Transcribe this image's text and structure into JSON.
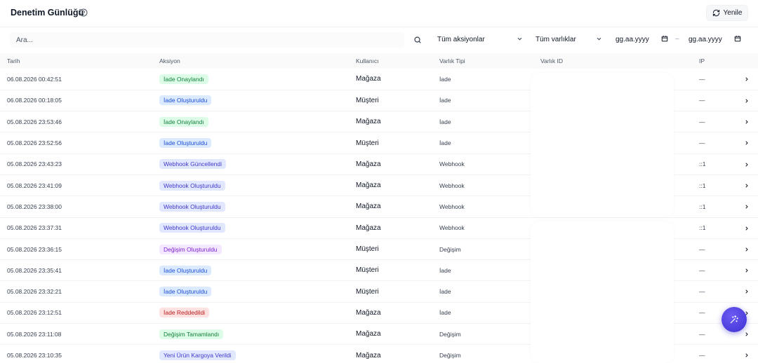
{
  "header": {
    "title": "Denetim Günlüğü",
    "refresh_label": "Yenile"
  },
  "filters": {
    "search_placeholder": "Ara...",
    "action_select": "Tüm aksiyonlar",
    "entity_select": "Tüm varlıklar",
    "date_from_placeholder": "gg.aa.yyyy",
    "date_to_placeholder": "gg.aa.yyyy",
    "date_separator": "–"
  },
  "table": {
    "columns": [
      "Tarih",
      "Aksiyon",
      "Kullanıcı",
      "Varlık Tipi",
      "Varlık ID",
      "IP"
    ],
    "rows": [
      {
        "date": "06.08.2026 00:42:51",
        "action": "İade Onaylandı",
        "color": "green",
        "user": "Mağaza",
        "entity_type": "İade",
        "ip": "—"
      },
      {
        "date": "06.08.2026 00:18:05",
        "action": "İade Oluşturuldu",
        "color": "blue",
        "user": "Müşteri",
        "entity_type": "İade",
        "ip": "—"
      },
      {
        "date": "05.08.2026 23:53:46",
        "action": "İade Onaylandı",
        "color": "green",
        "user": "Mağaza",
        "entity_type": "İade",
        "ip": "—"
      },
      {
        "date": "05.08.2026 23:52:56",
        "action": "İade Oluşturuldu",
        "color": "blue",
        "user": "Müşteri",
        "entity_type": "İade",
        "ip": "—"
      },
      {
        "date": "05.08.2026 23:43:23",
        "action": "Webhook Güncellendi",
        "color": "indigo",
        "user": "Mağaza",
        "entity_type": "Webhook",
        "ip": "::1"
      },
      {
        "date": "05.08.2026 23:41:09",
        "action": "Webhook Oluşturuldu",
        "color": "indigo",
        "user": "Mağaza",
        "entity_type": "Webhook",
        "ip": "::1"
      },
      {
        "date": "05.08.2026 23:38:00",
        "action": "Webhook Oluşturuldu",
        "color": "indigo",
        "user": "Mağaza",
        "entity_type": "Webhook",
        "ip": "::1"
      },
      {
        "date": "05.08.2026 23:37:31",
        "action": "Webhook Oluşturuldu",
        "color": "indigo",
        "user": "Mağaza",
        "entity_type": "Webhook",
        "ip": "::1"
      },
      {
        "date": "05.08.2026 23:36:15",
        "action": "Değişim Oluşturuldu",
        "color": "purple",
        "user": "Müşteri",
        "entity_type": "Değişim",
        "ip": "—"
      },
      {
        "date": "05.08.2026 23:35:41",
        "action": "İade Oluşturuldu",
        "color": "blue",
        "user": "Müşteri",
        "entity_type": "İade",
        "ip": "—"
      },
      {
        "date": "05.08.2026 23:32:21",
        "action": "İade Oluşturuldu",
        "color": "blue",
        "user": "Müşteri",
        "entity_type": "İade",
        "ip": "—"
      },
      {
        "date": "05.08.2026 23:12:51",
        "action": "İade Reddedildi",
        "color": "red",
        "user": "Mağaza",
        "entity_type": "İade",
        "ip": "—"
      },
      {
        "date": "05.08.2026 23:11:08",
        "action": "Değişim Tamamlandı",
        "color": "green",
        "user": "Mağaza",
        "entity_type": "Değişim",
        "ip": "—"
      },
      {
        "date": "05.08.2026 23:10:35",
        "action": "Yeni Ürün Kargoya Verildi",
        "color": "indigo",
        "user": "Mağaza",
        "entity_type": "Değişim",
        "ip": "—"
      }
    ]
  },
  "colors": {
    "accent": "#4f46e5",
    "badge_green": "#dcfce7",
    "badge_blue": "#dbeafe",
    "badge_indigo": "#e0e7ff",
    "badge_purple": "#f3e8ff",
    "badge_red": "#fee2e2"
  },
  "icons": {
    "help": "help-circle-icon",
    "refresh": "refresh-icon",
    "search": "search-icon",
    "chevron": "chevron-down-icon",
    "calendar": "calendar-icon",
    "row": "chevron-right-icon",
    "fab": "sparkle-icon"
  }
}
